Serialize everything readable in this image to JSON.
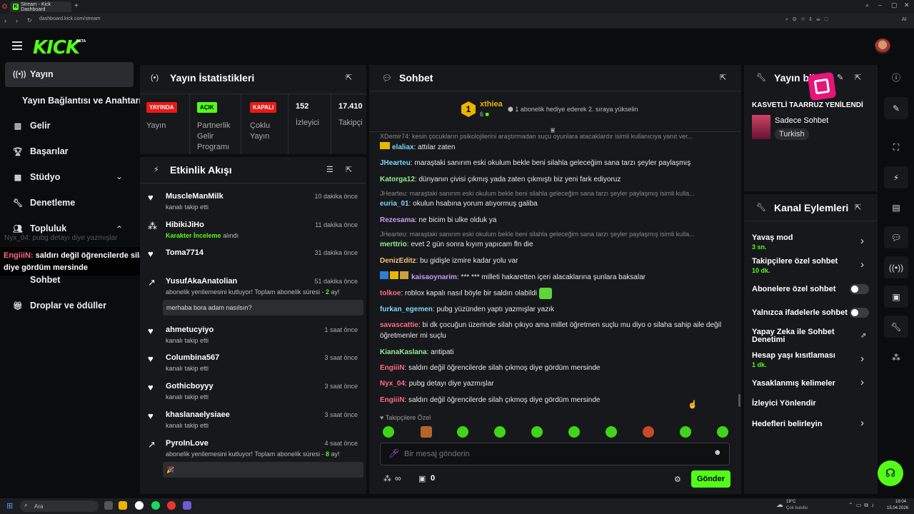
{
  "browser": {
    "tab_title": "Stream - Kick Dashboard",
    "url": "dashboard.kick.com/stream"
  },
  "app": {
    "logo": "KICK",
    "beta": "BETA"
  },
  "sidebar": {
    "items": [
      {
        "label": "Yayın",
        "icon": "stream-icon"
      },
      {
        "label": "Yayın Bağlantısı ve Anahtarı",
        "icon": ""
      },
      {
        "label": "Gelir",
        "icon": "chart-icon"
      },
      {
        "label": "Başarılar",
        "icon": "trophy-icon"
      },
      {
        "label": "Stüdyo",
        "icon": "studio-icon"
      },
      {
        "label": "Denetleme",
        "icon": "wrench-icon"
      },
      {
        "label": "Topluluk",
        "icon": "users-icon"
      },
      {
        "label": "Sohbet",
        "icon": ""
      },
      {
        "label": "Droplar ve ödüller",
        "icon": "gift-icon"
      }
    ],
    "overlay_ghost": "Nyx_04: pubg detayı diye yazmışlar",
    "overlay_user": "EngiiiN:",
    "overlay_text": "saldırı değil öğrencilerde silah çıkmoş diye gördüm mersinde"
  },
  "stats": {
    "title": "Yayın İstatistikleri",
    "live_badge": "YAYINDA",
    "live_label": "Yayın",
    "open_badge": "AÇIK",
    "partner_label": "Partnerlik Gelir Programı",
    "closed_badge": "KAPALI",
    "multi_label": "Çoklu Yayın",
    "viewers_value": "152",
    "viewers_label": "İzleyici",
    "followers_value": "17.410",
    "followers_label": "Takipçi"
  },
  "activity": {
    "title": "Etkinlik Akışı",
    "items": [
      {
        "name": "MuscleManMilk",
        "time": "10 dakika önce",
        "sub": "kanalı takip etti"
      },
      {
        "name": "HibikiJiHo",
        "time": "11 dakika önce",
        "sub_hl": "Karakter İnceleme",
        "sub": "alındı"
      },
      {
        "name": "Toma7714",
        "time": "31 dakika önce",
        "sub": ""
      },
      {
        "name": "YusufAkaAnatolian",
        "time": "51 dakika önce",
        "sub": "abonelik yenilemesini kutluyor! Toplam abonelik süresi -",
        "months": "2",
        "ay": "ay!",
        "msg": "merhaba bora adam nasılsın?"
      },
      {
        "name": "ahmetucyiyo",
        "time": "1 saat önce",
        "sub": "kanalı takip etti"
      },
      {
        "name": "Columbina567",
        "time": "3 saat önce",
        "sub": "kanalı takip etti"
      },
      {
        "name": "Gothicboyyy",
        "time": "3 saat önce",
        "sub": "kanalı takip etti"
      },
      {
        "name": "khaslanaelysiaee",
        "time": "3 saat önce",
        "sub": "kanalı takip etti"
      },
      {
        "name": "PyroInLove",
        "time": "4 saat önce",
        "sub": "abonelik yenilemesini kutluyor! Toplam abonelik süresi -",
        "months": "8",
        "ay": "ay!",
        "msg": "🎉"
      }
    ]
  },
  "chat": {
    "title": "Sohbet",
    "top_user": "xthiea",
    "top_rank": "1",
    "top_count": "6",
    "top_note": "1 abonelik hediye ederek 2. sıraya yükselin",
    "messages": [
      {
        "reply": "XDemir74: kesin çocukların psikolojilerini araştırmadan suçu oyunlara atacaklardır isimli kullanıcıya yanıt ver..."
      },
      {
        "user": "elaliax",
        "color": "#7cd6f5",
        "text": "attılar zaten"
      },
      {
        "user": "JHearteu",
        "color": "#7cd6f5",
        "text": "maraştaki sanırım eski okulum bekle beni silahla geleceğim sana tarzı şeyler paylaşmış"
      },
      {
        "user": "Katorga12",
        "color": "#8fef8f",
        "text": "dünyanın çivisi çıkmış yada zaten çıkmıştı biz yeni fark ediyoruz"
      },
      {
        "reply": "JHearteu: maraştaki sanırım eski okulum bekle beni silahla geleceğim sana tarzı şeyler paylaşmış isimli kulla..."
      },
      {
        "user": "euria_01",
        "color": "#7cd6f5",
        "text": "okulun hsabına yorum atıyormuş galiba"
      },
      {
        "user": "Rezesama",
        "color": "#c79bf2",
        "text": "ne bicim bi ulke olduk ya"
      },
      {
        "reply": "JHearteu: maraştaki sanırım eski okulum bekle beni silahla geleceğim sana tarzı şeyler paylaşmış isimli kulla..."
      },
      {
        "user": "merttrio",
        "color": "#8fef8f",
        "text": "evet 2 gün sonra kıyım yapıcam fln die"
      },
      {
        "user": "DenizEditz",
        "color": "#f2c27a",
        "text": "bu gidişle izmire kadar yolu var"
      },
      {
        "user": "kaisaoynarim",
        "color": "#c79bf2",
        "text": "*** *** milleti hakaretten içeri alacaklarına şunlara baksalar"
      },
      {
        "user": "tolkoe",
        "color": "#ff6b81",
        "text": "roblox kapalı nasıl böyle bir saldırı olabildi"
      },
      {
        "user": "furkan_egemen",
        "color": "#7cd6f5",
        "text": "pubg yüzünden yaptı yazmışlar yazık"
      },
      {
        "user": "savascattie",
        "color": "#ff6b81",
        "text": "bi dk çocuğun üzerinde silah çıkıyo ama millet öğretmen suçlu mu diyo o silaha sahip aile değil öğretmenler mi suçlu"
      },
      {
        "user": "KianaKaslana",
        "color": "#8fef8f",
        "text": "antipati"
      },
      {
        "user": "EngiiiN",
        "color": "#ff6b81",
        "text": "saldırı değil öğrencilerde silah çıkmoş diye gördüm mersinde"
      },
      {
        "user": "Nyx_04",
        "color": "#ff6b81",
        "text": "pubg detayı diye yazmışlar"
      },
      {
        "user": "EngiiiN",
        "color": "#ff6b81",
        "text": "saldırı değil öğrencilerde silah çıkmoş diye gördüm mersinde"
      }
    ],
    "followers_only": "Takipçilere Özel",
    "input_placeholder": "Bir mesaj gönderin",
    "points": "∞",
    "gifts": "0",
    "send": "Gönder"
  },
  "stream_info": {
    "title": "Yayın bilgisi",
    "stream_title": "KASVETLİ TAARRUZ YENİLENDİ",
    "category": "Sadece Sohbet",
    "tag": "Turkish"
  },
  "channel_actions": {
    "title": "Kanal Eylemleri",
    "items": [
      {
        "label": "Yavaş mod",
        "value": "3 sn.",
        "kind": "chevron"
      },
      {
        "label": "Takipçilere özel sohbet",
        "value": "10 dk.",
        "kind": "chevron"
      },
      {
        "label": "Abonelere özel sohbet",
        "value": "",
        "kind": "toggle"
      },
      {
        "label": "Yalnızca ifadelerle sohbet",
        "value": "",
        "kind": "toggle"
      },
      {
        "label": "Yapay Zeka ile Sohbet Denetimi",
        "value": "",
        "kind": "external"
      },
      {
        "label": "Hesap yaşı kısıtlaması",
        "value": "1 dk.",
        "kind": "chevron"
      },
      {
        "label": "Yasaklanmış kelimeler",
        "value": "",
        "kind": "chevron"
      },
      {
        "label": "İzleyici Yönlendir",
        "value": "",
        "kind": "none"
      },
      {
        "label": "Hedefleri belirleyin",
        "value": "",
        "kind": "chevron"
      }
    ]
  },
  "taskbar": {
    "search": "Ara",
    "weather": "19°C",
    "weather_desc": "Çok bulutlu",
    "time": "18:04",
    "date": "15.04.2026"
  },
  "colors": {
    "accent": "#53fc18",
    "panel": "#17181b",
    "live": "#e91916"
  }
}
